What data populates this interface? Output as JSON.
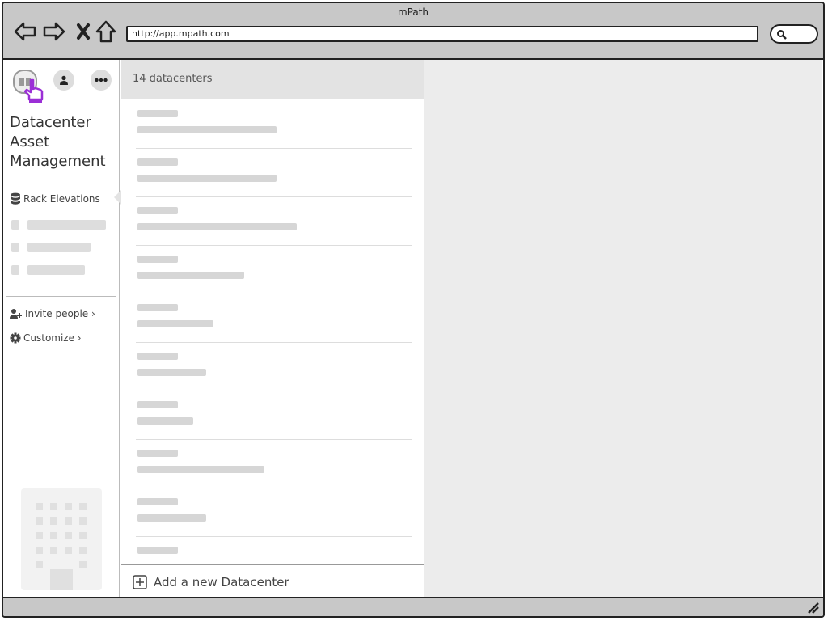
{
  "window": {
    "title": "mPath"
  },
  "browser": {
    "url": "http://app.mpath.com",
    "nav_icons": [
      "back-arrow-icon",
      "forward-arrow-icon",
      "close-x-icon",
      "home-icon"
    ],
    "search_icon": "magnifier-icon"
  },
  "sidebar": {
    "top_icons": [
      "apps-grid-icon",
      "user-icon",
      "more-dots-icon"
    ],
    "app_title_lines": [
      "Datacenter",
      "Asset",
      "Management"
    ],
    "nav": {
      "label": "Rack Elevations",
      "icon": "database-icon"
    },
    "actions": [
      {
        "label": "Invite people ›",
        "icon": "add-user-icon"
      },
      {
        "label": "Customize ›",
        "icon": "gear-icon"
      }
    ],
    "illustration": "building-icon"
  },
  "list": {
    "header": "14 datacenters",
    "add_label": "Add a new Datacenter",
    "add_icon": "plus-square-icon"
  },
  "colors": {
    "accent": "#9b2fd6",
    "chrome": "#c8c8c8",
    "detail_bg": "#ececec"
  }
}
